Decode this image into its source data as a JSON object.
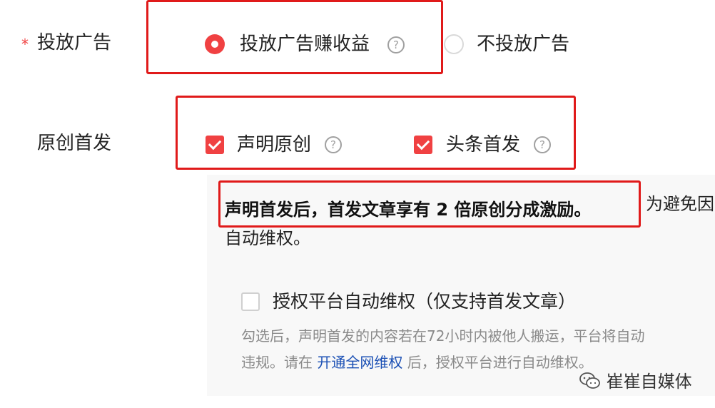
{
  "ads": {
    "required_mark": "*",
    "label": "投放广告",
    "option_on": "投放广告赚收益",
    "option_off": "不投放广告",
    "help": "?"
  },
  "original": {
    "label": "原创首发",
    "option1": "声明原创",
    "option2": "头条首发",
    "help": "?"
  },
  "notice": {
    "highlight": "声明首发后，首发文章享有 2 倍原创分成激励。",
    "rest": "为避免因",
    "line2": "自动维权。"
  },
  "authorize": {
    "label": "授权平台自动维权（仅支持首发文章）",
    "desc1": "勾选后，声明首发的内容若在72小时内被他人搬运，平台将自动",
    "desc2_prefix": "违规。请在",
    "desc2_link": "开通全网维权",
    "desc2_suffix": "后，授权平台进行自动维权。"
  },
  "watermark": {
    "text": "崔崔自媒体",
    "icon": "wechat-icon"
  },
  "colors": {
    "accent": "#f04142",
    "highlight_box": "#e01a1a",
    "link": "#1a4fb4"
  }
}
